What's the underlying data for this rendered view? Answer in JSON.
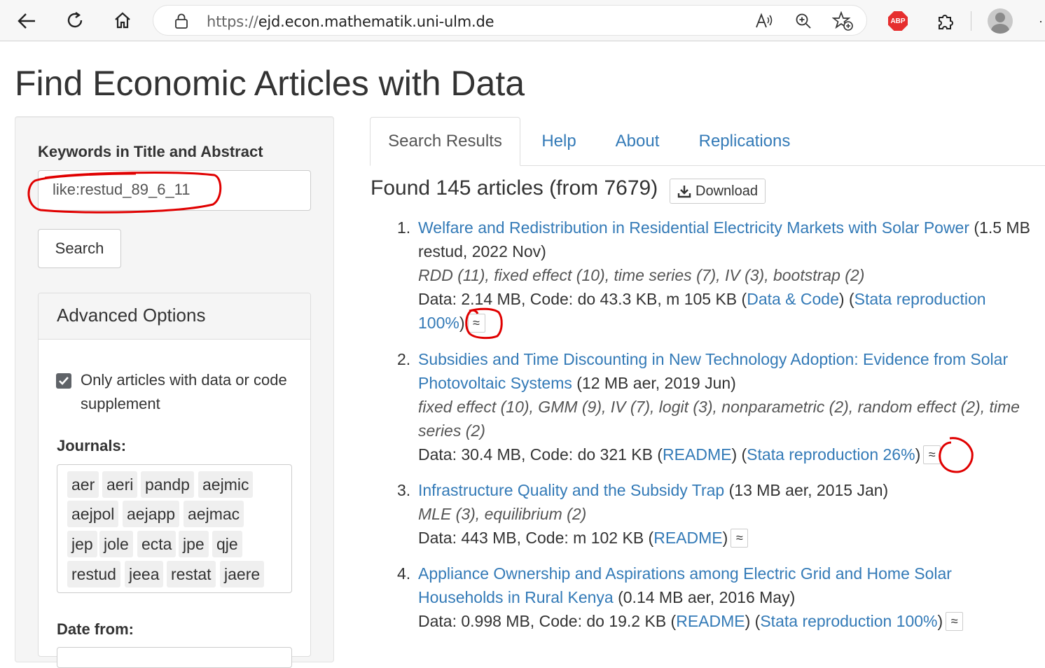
{
  "browser": {
    "url_scheme": "https://",
    "url_host": "ejd.econ.mathematik.uni-ulm.de",
    "abp_label": "ABP"
  },
  "page": {
    "title": "Find Economic Articles with Data"
  },
  "sidebar": {
    "keywords_label": "Keywords in Title and Abstract",
    "keywords_value": "like:restud_89_6_11",
    "search_label": "Search",
    "advanced_title": "Advanced Options",
    "only_data_label": "Only articles with data or code supplement",
    "only_data_checked": true,
    "journals_label": "Journals:",
    "journals": [
      "aer",
      "aeri",
      "pandp",
      "aejmic",
      "aejpol",
      "aejapp",
      "aejmac",
      "jep",
      "jole",
      "ecta",
      "jpe",
      "qje",
      "restud",
      "jeea",
      "restat",
      "jaere"
    ],
    "date_from_label": "Date from:"
  },
  "tabs": [
    "Search Results",
    "Help",
    "About",
    "Replications"
  ],
  "results_header": {
    "found_text": "Found 145 articles (from 7679)",
    "download_label": "Download"
  },
  "results": [
    {
      "num": "1.",
      "title": "Welfare and Redistribution in Residential Electricity Markets with Solar Power",
      "meta": " (1.5 MB restud, 2022 Nov)",
      "tags": "RDD (11), fixed effect (10), time series (7), IV (3), bootstrap (2)",
      "data_prefix": "Data: 2.14 MB, Code: do 43.3 KB, m 105 KB (",
      "link1": "Data & Code",
      "mid": ") (",
      "link2": "Stata reproduction 100%",
      "end": ")",
      "approx": "≈"
    },
    {
      "num": "2.",
      "title": "Subsidies and Time Discounting in New Technology Adoption: Evidence from Solar Photovoltaic Systems",
      "meta": " (12 MB aer, 2019 Jun)",
      "tags": "fixed effect (10), GMM (9), IV (7), logit (3), nonparametric (2), random effect (2), time series (2)",
      "data_prefix": "Data: 30.4 MB, Code: do 321 KB (",
      "link1": "README",
      "mid": ") (",
      "link2": "Stata reproduction 26%",
      "end": ")",
      "approx": "≈"
    },
    {
      "num": "3.",
      "title": "Infrastructure Quality and the Subsidy Trap",
      "meta": " (13 MB aer, 2015 Jan)",
      "tags": "MLE (3), equilibrium (2)",
      "data_prefix": "Data: 443 MB, Code: m 102 KB (",
      "link1": "README",
      "end": ")",
      "approx": "≈"
    },
    {
      "num": "4.",
      "title": "Appliance Ownership and Aspirations among Electric Grid and Home Solar Households in Rural Kenya",
      "meta": " (0.14 MB aer, 2016 May)",
      "data_prefix": "Data: 0.998 MB, Code: do 19.2 KB (",
      "link1": "README",
      "mid": ") (",
      "link2": "Stata reproduction 100%",
      "end": ")",
      "approx": "≈"
    }
  ]
}
